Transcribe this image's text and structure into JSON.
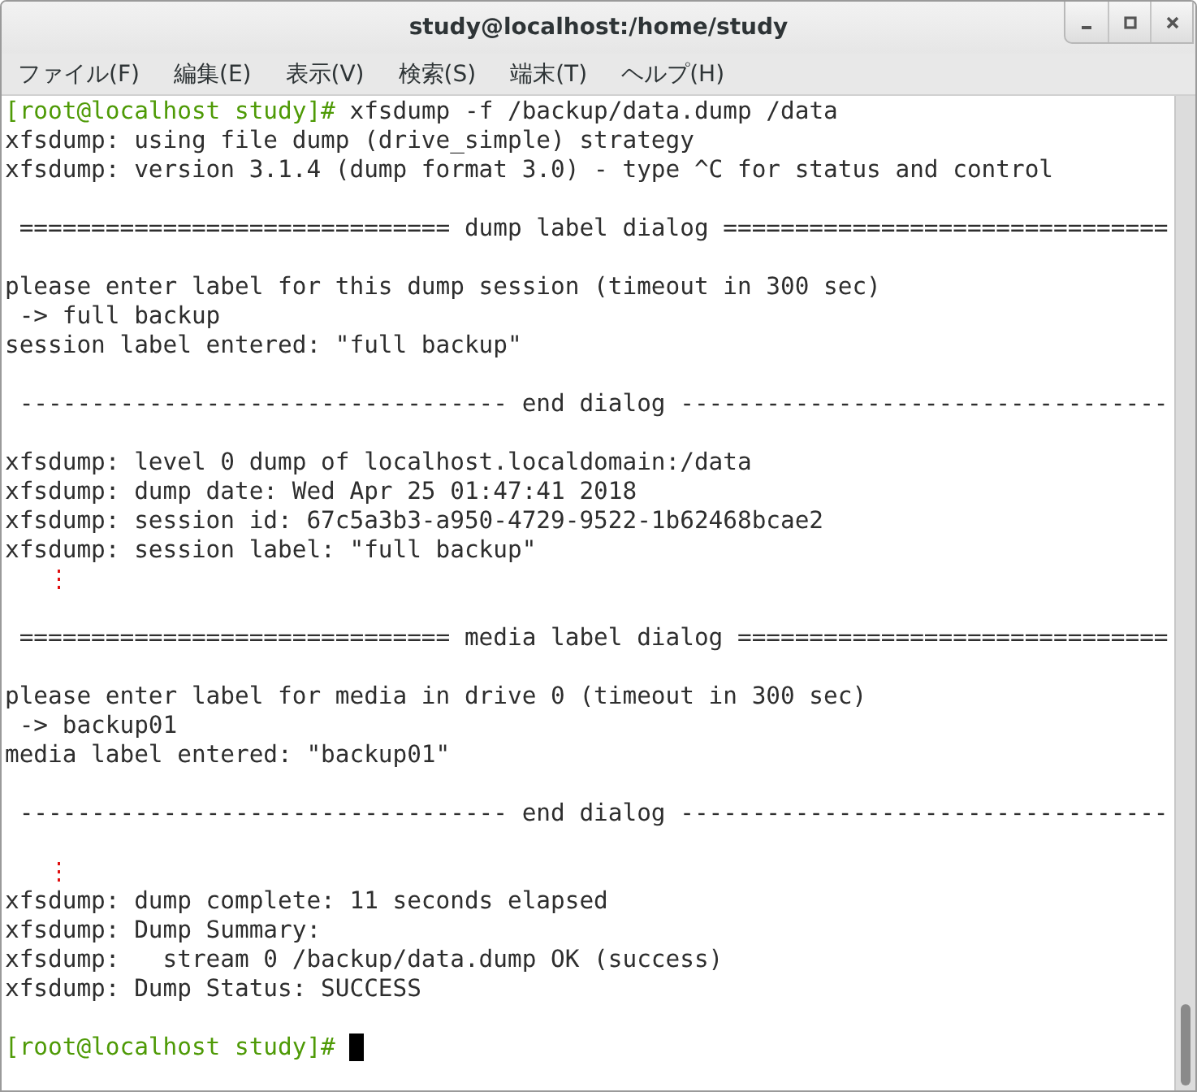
{
  "window": {
    "title": "study@localhost:/home/study"
  },
  "menu": [
    {
      "label": "ファイル(F)"
    },
    {
      "label": "編集(E)"
    },
    {
      "label": "表示(V)"
    },
    {
      "label": "検索(S)"
    },
    {
      "label": "端末(T)"
    },
    {
      "label": "ヘルプ(H)"
    }
  ],
  "lines": [
    {
      "kind": "prompt",
      "prompt": "[root@localhost study]#",
      "command": " xfsdump -f /backup/data.dump /data",
      "cursor": false
    },
    {
      "kind": "output",
      "text": "xfsdump: using file dump (drive_simple) strategy"
    },
    {
      "kind": "output",
      "text": "xfsdump: version 3.1.4 (dump format 3.0) - type ^C for status and control"
    },
    {
      "kind": "blank"
    },
    {
      "kind": "output",
      "text": " ============================== dump label dialog ==============================="
    },
    {
      "kind": "blank"
    },
    {
      "kind": "output",
      "text": "please enter label for this dump session (timeout in 300 sec)"
    },
    {
      "kind": "output",
      "text": " -> full backup"
    },
    {
      "kind": "output",
      "text": "session label entered: \"full backup\""
    },
    {
      "kind": "blank"
    },
    {
      "kind": "output",
      "text": " ---------------------------------- end dialog ----------------------------------"
    },
    {
      "kind": "blank"
    },
    {
      "kind": "output",
      "text": "xfsdump: level 0 dump of localhost.localdomain:/data"
    },
    {
      "kind": "output",
      "text": "xfsdump: dump date: Wed Apr 25 01:47:41 2018"
    },
    {
      "kind": "output",
      "text": "xfsdump: session id: 67c5a3b3-a950-4729-9522-1b62468bcae2"
    },
    {
      "kind": "output",
      "text": "xfsdump: session label: \"full backup\""
    },
    {
      "kind": "ellipsis",
      "text": "⋮"
    },
    {
      "kind": "blank"
    },
    {
      "kind": "output",
      "text": " ============================== media label dialog =============================="
    },
    {
      "kind": "blank"
    },
    {
      "kind": "output",
      "text": "please enter label for media in drive 0 (timeout in 300 sec)"
    },
    {
      "kind": "output",
      "text": " -> backup01"
    },
    {
      "kind": "output",
      "text": "media label entered: \"backup01\""
    },
    {
      "kind": "blank"
    },
    {
      "kind": "output",
      "text": " ---------------------------------- end dialog ----------------------------------"
    },
    {
      "kind": "blank"
    },
    {
      "kind": "ellipsis",
      "text": "⋮"
    },
    {
      "kind": "output",
      "text": "xfsdump: dump complete: 11 seconds elapsed"
    },
    {
      "kind": "output",
      "text": "xfsdump: Dump Summary:"
    },
    {
      "kind": "output",
      "text": "xfsdump:   stream 0 /backup/data.dump OK (success)"
    },
    {
      "kind": "output",
      "text": "xfsdump: Dump Status: SUCCESS"
    },
    {
      "kind": "blank"
    },
    {
      "kind": "prompt",
      "prompt": "[root@localhost study]#",
      "cursor": true
    }
  ]
}
